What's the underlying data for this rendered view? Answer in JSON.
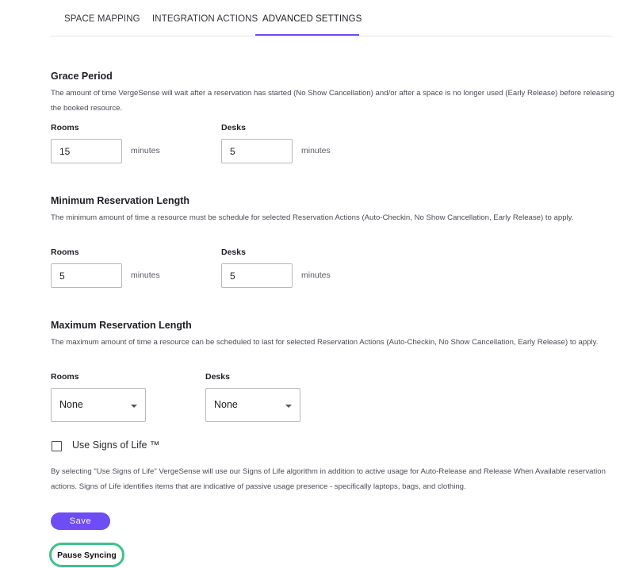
{
  "tabs": [
    {
      "label": "SPACE MAPPING"
    },
    {
      "label": "INTEGRATION ACTIONS"
    },
    {
      "label": "ADVANCED SETTINGS",
      "active": true
    }
  ],
  "grace_period": {
    "title": "Grace Period",
    "description": "The amount of time VergeSense will wait after a reservation has started (No Show Cancellation) and/or after a space is no longer used (Early Release) before releasing the booked resource.",
    "rooms_label": "Rooms",
    "rooms_value": "15",
    "desks_label": "Desks",
    "desks_value": "5",
    "unit": "minutes"
  },
  "min_length": {
    "title": "Minimum Reservation Length",
    "description": "The minimum amount of time a resource must be schedule for selected Reservation Actions (Auto-Checkin, No Show Cancellation, Early Release) to apply.",
    "rooms_label": "Rooms",
    "rooms_value": "5",
    "desks_label": "Desks",
    "desks_value": "5",
    "unit": "minutes"
  },
  "max_length": {
    "title": "Maximum Reservation Length",
    "description": "The maximum amount of time a resource can be scheduled to last for selected Reservation Actions (Auto-Checkin, No Show Cancellation, Early Release) to apply.",
    "rooms_label": "Rooms",
    "rooms_value": "None",
    "desks_label": "Desks",
    "desks_value": "None"
  },
  "signs_of_life": {
    "label": "Use Signs of Life ™",
    "checked": false,
    "description": "By selecting \"Use Signs of Life\" VergeSense will use our Signs of Life algorithm in addition to active usage for Auto-Release and Release When Available reservation actions. Signs of Life identifies items that are indicative of passive usage presence - specifically laptops, bags, and clothing."
  },
  "buttons": {
    "save": "Save",
    "pause_syncing": "Pause Syncing"
  },
  "colors": {
    "accent": "#6e4cf6",
    "pause_border": "#3fc28a"
  }
}
